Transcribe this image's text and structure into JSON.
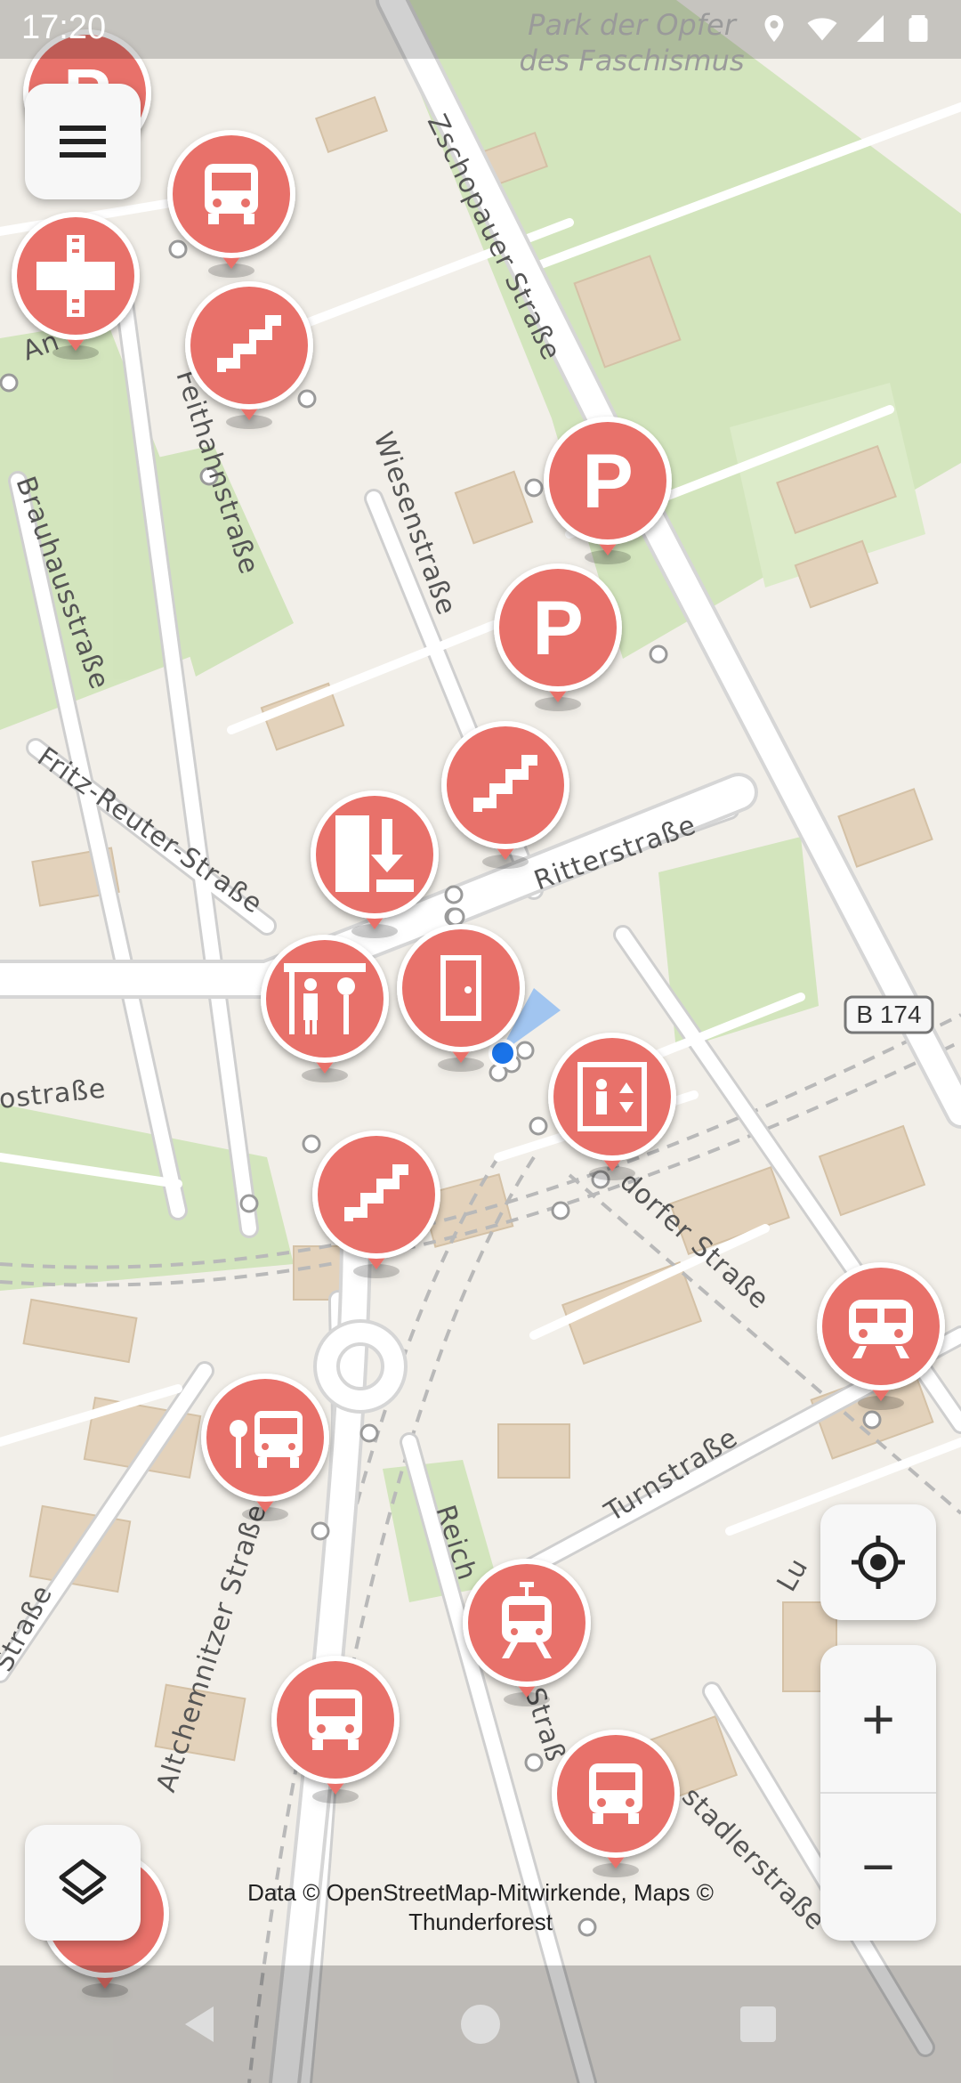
{
  "status_bar": {
    "time": "17:20",
    "icons": [
      "location-icon",
      "wifi-icon",
      "signal-icon",
      "battery-icon"
    ]
  },
  "map": {
    "park_label_line1": "Park der Opfer",
    "park_label_line2": "des Faschismus",
    "streets": [
      "Zschopauer Straße",
      "Brauhausstraße",
      "Wiesenstraße",
      "Fritz-Reuter-Straße",
      "Ritterstraße",
      "Altchemnitzer Straße",
      "Turnstraße",
      "dorfer Straße",
      "ostraße",
      "Reich",
      "Straß",
      "stadlerstraße",
      "Lu",
      "Straße",
      "An",
      "Feithahnstraße"
    ],
    "road_shield": "B 174",
    "markers": [
      {
        "icon": "parking-icon",
        "glyph": "P"
      },
      {
        "icon": "bus-icon"
      },
      {
        "icon": "railway-crossing-icon"
      },
      {
        "icon": "stairs-icon"
      },
      {
        "icon": "parking-icon",
        "glyph": "P"
      },
      {
        "icon": "parking-icon",
        "glyph": "P"
      },
      {
        "icon": "stairs-icon"
      },
      {
        "icon": "entrance-icon"
      },
      {
        "icon": "shelter-icon"
      },
      {
        "icon": "door-icon"
      },
      {
        "icon": "elevator-icon"
      },
      {
        "icon": "stairs-icon"
      },
      {
        "icon": "train-icon"
      },
      {
        "icon": "bus-stop-icon"
      },
      {
        "icon": "tram-icon"
      },
      {
        "icon": "bus-icon"
      },
      {
        "icon": "bus-icon"
      },
      {
        "icon": "marker-icon"
      }
    ]
  },
  "controls": {
    "menu": "menu-icon",
    "layers": "layers-icon",
    "locate": "my-location-icon",
    "zoom_in": "+",
    "zoom_out": "−"
  },
  "attribution": "Data © OpenStreetMap-Mitwirkende, Maps © Thunderforest",
  "colors": {
    "marker": "#e8716b",
    "marker_icon": "#ffffff",
    "map_bg": "#f2efe9",
    "park": "#cfe3b8",
    "road": "#ffffff",
    "building": "#e3d2bb"
  }
}
